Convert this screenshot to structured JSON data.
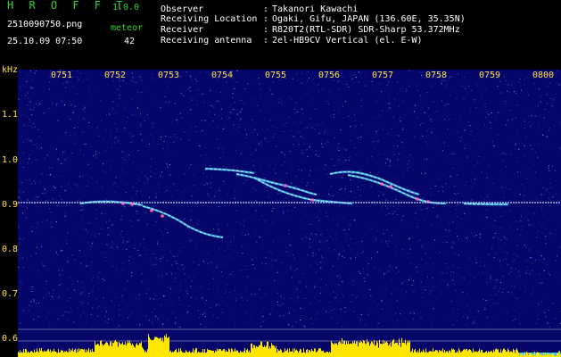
{
  "app": {
    "title": "H R O F F T",
    "version": "1.0.0"
  },
  "capture": {
    "filename": "2510090750.png",
    "datetime": "25.10.09 07:50",
    "meteor_label": "meteor",
    "meteor_count": "42"
  },
  "info": [
    {
      "key": "Observer",
      "value": "Takanori Kawachi"
    },
    {
      "key": "Receiving Location",
      "value": "Ogaki, Gifu, JAPAN (136.60E, 35.35N)"
    },
    {
      "key": "Receiver",
      "value": "R820T2(RTL-SDR) SDR-Sharp 53.372MHz"
    },
    {
      "key": "Receiving antenna",
      "value": "2el-HB9CV Vertical (el. E-W)"
    }
  ],
  "info_sep": ":",
  "yaxis": {
    "unit": "kHz",
    "ticks": [
      "1.1",
      "1.0",
      "0.9",
      "0.8",
      "0.7",
      "0.6"
    ]
  },
  "xaxis": {
    "ticks": [
      "0751",
      "0752",
      "0753",
      "0754",
      "0755",
      "0756",
      "0757",
      "0758",
      "0759",
      "0800"
    ]
  },
  "colors": {
    "background": "#05056a",
    "text_green": "#32d232",
    "text_white": "#ffffff",
    "axis_yellow": "#ffe14a",
    "carrier_line": "#b8d8ff",
    "level_bar": "#ffe600",
    "level_base": "#33c0ff"
  }
}
